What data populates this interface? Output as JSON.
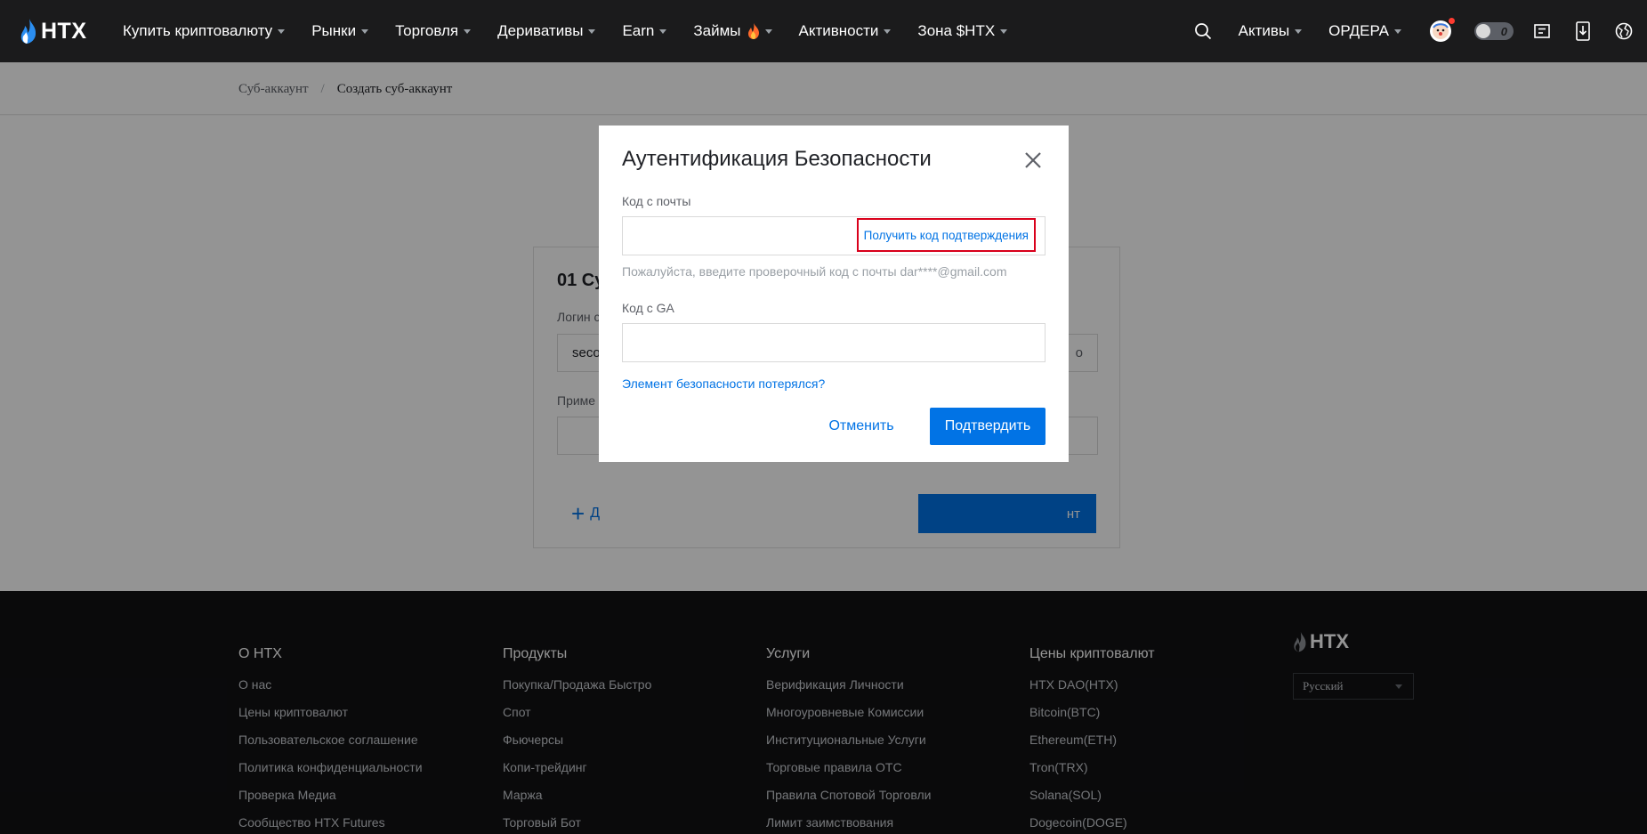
{
  "header": {
    "logo_text": "HTX",
    "nav": [
      {
        "label": "Купить криптовалюту"
      },
      {
        "label": "Рынки"
      },
      {
        "label": "Торговля"
      },
      {
        "label": "Деривативы"
      },
      {
        "label": "Earn"
      },
      {
        "label": "Займы"
      },
      {
        "label": "Активности"
      },
      {
        "label": "Зона $HTX"
      }
    ],
    "assets_label": "Активы",
    "orders_label": "ОРДЕРА",
    "toggle_value": "0",
    "icons": [
      "search-icon",
      "avatar-icon",
      "toggle-icon",
      "orders-list-icon",
      "download-icon",
      "language-icon"
    ]
  },
  "breadcrumb": {
    "parent": "Суб-аккаунт",
    "separator": "/",
    "current": "Создать суб-аккаунт"
  },
  "background_card": {
    "title": "01 Су",
    "login_label": "Логин с",
    "login_value": "seco",
    "login_tail": "o",
    "note_label": "Приме",
    "add_label": "Д",
    "submit_tail": "нт"
  },
  "modal": {
    "title": "Аутентификация Безопасности",
    "email_code_label": "Код с почты",
    "email_code_value": "",
    "get_code_button": "Получить код подтверждения",
    "email_hint": "Пожалуйста, введите проверочный код с почты dar****@gmail.com",
    "ga_code_label": "Код с GA",
    "ga_code_value": "",
    "lost_security_link": "Элемент безопасности потерялся?",
    "cancel_button": "Отменить",
    "confirm_button": "Подтвердить"
  },
  "footer": {
    "columns": [
      {
        "heading": "О HTX",
        "links": [
          "О нас",
          "Цены криптовалют",
          "Пользовательское соглашение",
          "Политика конфиденциальности",
          "Проверка Медиа",
          "Сообщество HTX Futures"
        ]
      },
      {
        "heading": "Продукты",
        "links": [
          "Покупка/Продажа Быстро",
          "Спот",
          "Фьючерсы",
          "Копи-трейдинг",
          "Маржа",
          "Торговый Бот"
        ]
      },
      {
        "heading": "Услуги",
        "links": [
          "Верификация Личности",
          "Многоуровневые Комиссии",
          "Институциональные Услуги",
          "Торговые правила OTC",
          "Правила Спотовой Торговли",
          "Лимит заимствования"
        ]
      },
      {
        "heading": "Цены криптовалют",
        "links": [
          "HTX DAO(HTX)",
          "Bitcoin(BTC)",
          "Ethereum(ETH)",
          "Tron(TRX)",
          "Solana(SOL)",
          "Dogecoin(DOGE)"
        ]
      }
    ],
    "logo_text": "HTX",
    "language": "Русский"
  },
  "colors": {
    "accent": "#0173e5",
    "nav_bg": "#1b1b1c",
    "footer_bg": "#121214",
    "highlight_border": "#d9001b"
  }
}
